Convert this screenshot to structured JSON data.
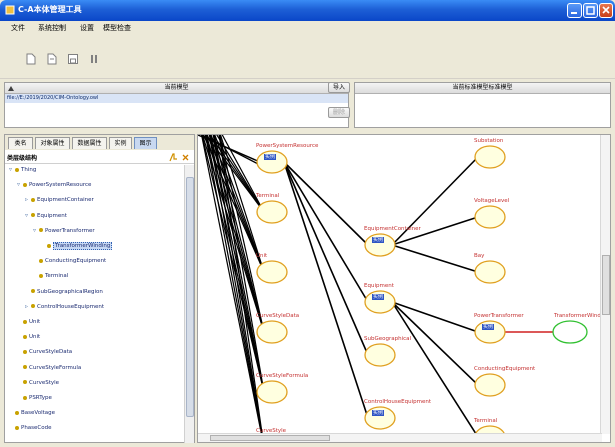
{
  "window": {
    "title": "C-A本体管理工具"
  },
  "menu": [
    "文件",
    "系统控制",
    "设置",
    "模型检查"
  ],
  "current_panel": {
    "header": "当前模型",
    "row": "file://E:/2019/2020/CIM-Ontology.owl",
    "buttons": [
      "导入",
      "删除"
    ]
  },
  "standard_panel": {
    "header": "当前标准模型标准模型"
  },
  "tabs": [
    "类名",
    "对象属性",
    "数据属性",
    "实例",
    "图示"
  ],
  "tree": {
    "header": "类层级结构",
    "nodes": [
      {
        "label": "Thing",
        "depth": 0,
        "exp": "▿"
      },
      {
        "label": "PowerSystemResource",
        "depth": 1,
        "exp": "▿"
      },
      {
        "label": "EquipmentContainer",
        "depth": 2,
        "exp": "▹"
      },
      {
        "label": "Equipment",
        "depth": 2,
        "exp": "▿"
      },
      {
        "label": "PowerTransformer",
        "depth": 3,
        "exp": "▿"
      },
      {
        "label": "TransformerWinding",
        "depth": 4,
        "exp": "",
        "selected": true
      },
      {
        "label": "ConductingEquipment",
        "depth": 3,
        "exp": ""
      },
      {
        "label": "Terminal",
        "depth": 3,
        "exp": ""
      },
      {
        "label": "SubGeographicalRegion",
        "depth": 2,
        "exp": ""
      },
      {
        "label": "ControlHouseEquipment",
        "depth": 2,
        "exp": "▹"
      },
      {
        "label": "Unit",
        "depth": 1,
        "exp": ""
      },
      {
        "label": "Unit",
        "depth": 1,
        "exp": ""
      },
      {
        "label": "CurveStyleData",
        "depth": 1,
        "exp": ""
      },
      {
        "label": "CurveStyleFormula",
        "depth": 1,
        "exp": ""
      },
      {
        "label": "CurveStyle",
        "depth": 1,
        "exp": ""
      },
      {
        "label": "PSRType",
        "depth": 1,
        "exp": ""
      },
      {
        "label": "BaseVoltage",
        "depth": 0,
        "exp": ""
      },
      {
        "label": "PhaseCode",
        "depth": 0,
        "exp": ""
      }
    ]
  },
  "graph": {
    "nodes": [
      {
        "id": "psr",
        "label": "PowerSystemResource",
        "tag": "实例"
      },
      {
        "id": "terminal",
        "label": "Terminal"
      },
      {
        "id": "unit",
        "label": "Unit"
      },
      {
        "id": "csd",
        "label": "CurveStyleData"
      },
      {
        "id": "csf",
        "label": "CurveStyleFormula"
      },
      {
        "id": "cs",
        "label": "CurveStyle"
      },
      {
        "id": "ec",
        "label": "EquipmentContainer",
        "tag": "实例"
      },
      {
        "id": "eq",
        "label": "Equipment",
        "tag": "实例"
      },
      {
        "id": "sgr",
        "label": "SubGeographical"
      },
      {
        "id": "che",
        "label": "ControlHouseEquipment",
        "tag": "实例"
      },
      {
        "id": "sub",
        "label": "Substation"
      },
      {
        "id": "vl",
        "label": "VoltageLevel"
      },
      {
        "id": "bay",
        "label": "Bay"
      },
      {
        "id": "pt",
        "label": "PowerTransformer",
        "tag": "实例"
      },
      {
        "id": "ce",
        "label": "ConductingEquipment"
      },
      {
        "id": "tm",
        "label": "Terminal"
      },
      {
        "id": "tw",
        "label": "TransformerWinding"
      }
    ]
  },
  "colors": {
    "link": "#000000",
    "selected_link": "#d02020",
    "node_fill": "#ffffe0",
    "node_stroke": "#e0a020",
    "selected_stroke": "#30c030"
  }
}
